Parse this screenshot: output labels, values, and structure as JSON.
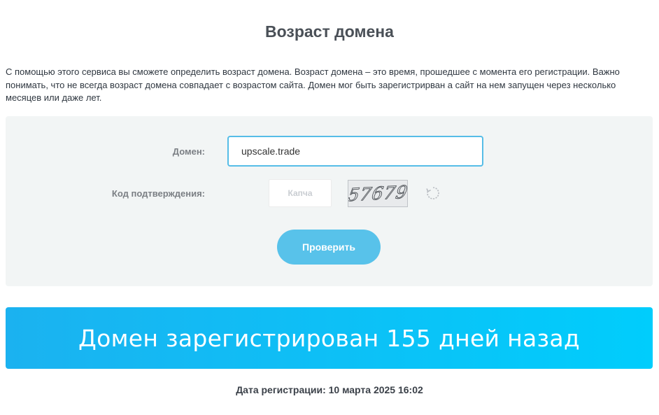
{
  "page": {
    "title": "Возраст домена",
    "intro": "С помощью этого сервиса вы сможете определить возраст домена. Возраст домена – это время, прошедшее с момента его регистрации. Важно понимать, что не всегда возраст домена совпадает с возрастом сайта. Домен мог быть зарегистрирван а сайт на нем запущен через несколько месяцев или даже лет."
  },
  "form": {
    "domain_label": "Домен:",
    "domain_value": "upscale.trade",
    "captcha_label": "Код подтверждения:",
    "captcha_placeholder": "Капча",
    "captcha_image_text": "57679",
    "refresh_icon": "refresh-icon",
    "submit_label": "Проверить"
  },
  "result": {
    "banner_text": "Домен зарегистрирован 155 дней назад",
    "registration_date": "Дата регистрации: 10 марта 2025 16:02"
  },
  "colors": {
    "accent": "#58c2ea",
    "input_border": "#56bde7",
    "banner_start": "#1bb2f0",
    "banner_end": "#00cdfc",
    "form_background": "#f2f5f5"
  }
}
